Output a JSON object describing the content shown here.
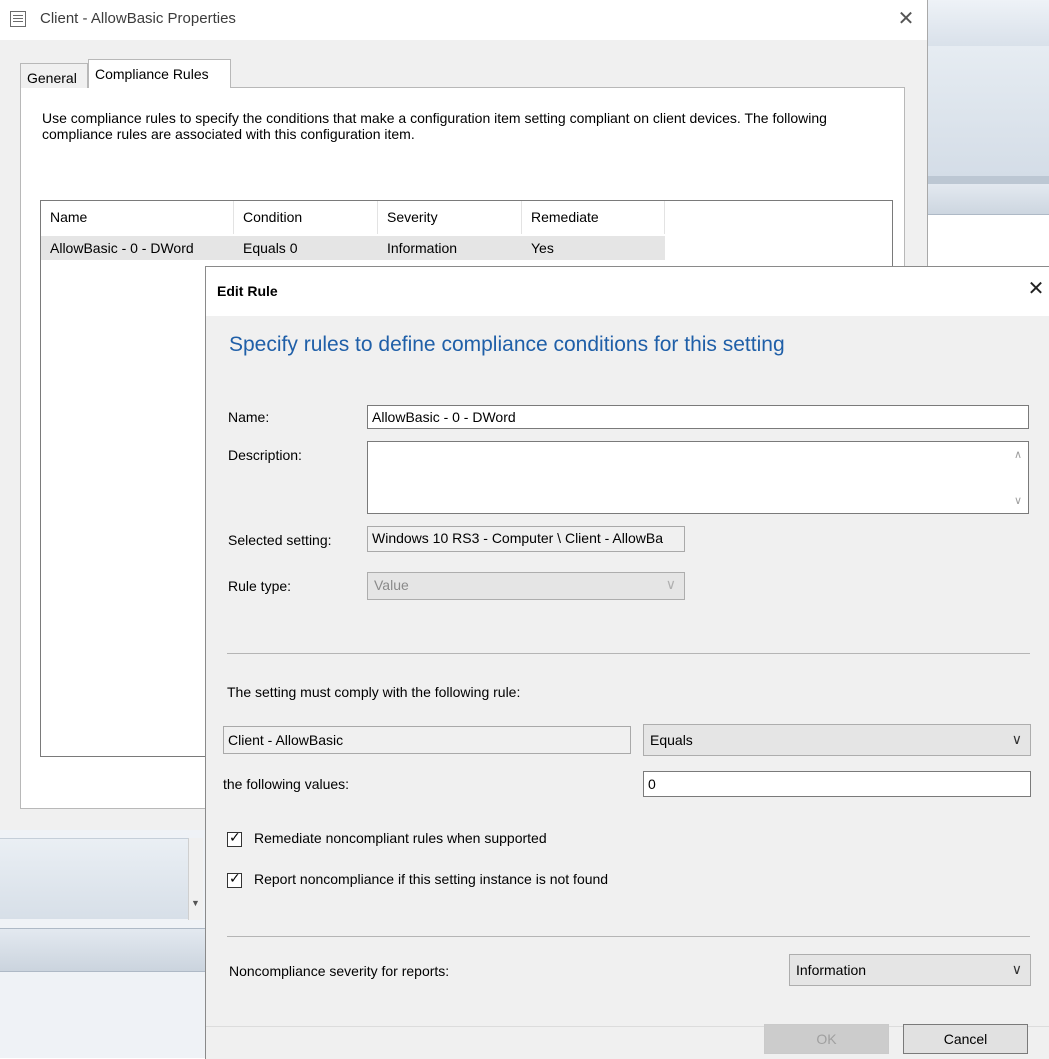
{
  "properties_window": {
    "title": "Client - AllowBasic Properties",
    "close_glyph": "✕",
    "tabs": [
      {
        "label": "General",
        "active": false
      },
      {
        "label": "Compliance Rules",
        "active": true
      }
    ],
    "intro_text": "Use compliance rules to specify the conditions that make a configuration item setting compliant on client devices. The following compliance rules are associated with this configuration item.",
    "list": {
      "columns": [
        "Name",
        "Condition",
        "Severity",
        "Remediate"
      ],
      "rows": [
        {
          "name": "AllowBasic - 0 - DWord",
          "condition": "Equals 0",
          "severity": "Information",
          "remediate": "Yes"
        }
      ]
    }
  },
  "edit_rule": {
    "title": "Edit Rule",
    "close_glyph": "✕",
    "heading": "Specify rules to define compliance conditions for this setting",
    "name_label": "Name:",
    "name_value": "AllowBasic - 0 - DWord",
    "description_label": "Description:",
    "description_value": "",
    "selected_setting_label": "Selected setting:",
    "selected_setting_value": "Windows 10 RS3 - Computer \\ Client - AllowBa",
    "rule_type_label": "Rule type:",
    "rule_type_value": "Value",
    "comply_text": "The setting must comply with the following rule:",
    "setting_name": "Client - AllowBasic",
    "operator_value": "Equals",
    "values_label": "the following values:",
    "values_value": "0",
    "remediate_label": "Remediate noncompliant rules when supported",
    "remediate_checked": true,
    "report_label": "Report noncompliance if this setting instance is not found",
    "report_checked": true,
    "severity_label": "Noncompliance severity for reports:",
    "severity_value": "Information",
    "ok_label": "OK",
    "cancel_label": "Cancel"
  },
  "icons": {
    "dropdown": "chevron-down-icon",
    "close": "close-icon",
    "checkbox": "checkmark-icon"
  },
  "colors": {
    "heading_blue": "#1f5fa8",
    "selected_row": "#e5e5e5",
    "dialog_bg": "#f0f0f0"
  }
}
